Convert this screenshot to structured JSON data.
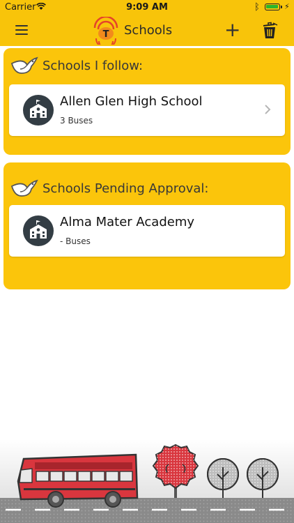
{
  "status_bar": {
    "carrier": "Carrier",
    "time": "9:09 AM"
  },
  "nav": {
    "title": "Schools",
    "add_label": "+",
    "icons": [
      "menu-icon",
      "app-logo",
      "add-icon",
      "trash-icon"
    ]
  },
  "followed": {
    "title": "Schools I follow:",
    "schools": [
      {
        "name": "Allen Glen High School",
        "buses": "3 Buses"
      }
    ]
  },
  "pending": {
    "title": "Schools Pending Approval:",
    "schools": [
      {
        "name": "Alma Mater Academy",
        "buses": "- Buses"
      }
    ]
  },
  "colors": {
    "accent": "#f8c40a",
    "card": "#fbc50b",
    "icon_dark": "#333d44",
    "bus_red": "#d9363e"
  }
}
